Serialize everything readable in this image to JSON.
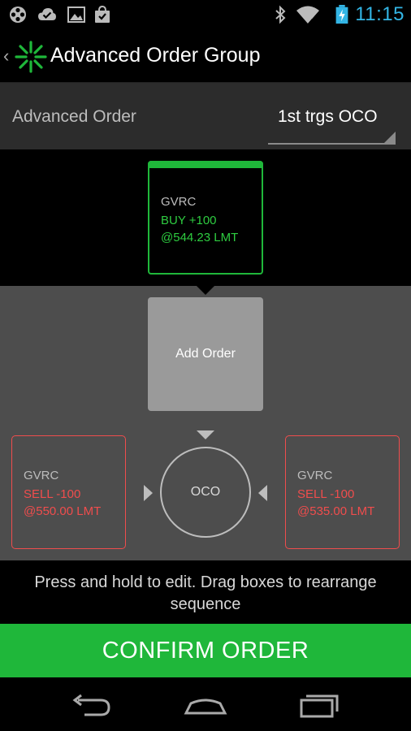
{
  "status_bar": {
    "time": "11:15",
    "icons": [
      "film-reel-icon",
      "cloud-check-icon",
      "image-icon",
      "shopping-bag-icon",
      "bluetooth-icon",
      "wifi-icon",
      "battery-charging-icon"
    ]
  },
  "action_bar": {
    "title": "Advanced Order Group",
    "logo_color": "#1fb73a"
  },
  "advanced_order": {
    "label": "Advanced Order",
    "selected": "1st trgs OCO"
  },
  "primary_order": {
    "symbol": "GVRC",
    "action": "BUY +100",
    "price": "@544.23 LMT",
    "color": "#1fb73a"
  },
  "add_order": {
    "label": "Add Order"
  },
  "oco": {
    "label": "OCO"
  },
  "left_order": {
    "symbol": "GVRC",
    "action": "SELL -100",
    "price": "@550.00 LMT",
    "color": "#f04d4d"
  },
  "right_order": {
    "symbol": "GVRC",
    "action": "SELL -100",
    "price": "@535.00 LMT",
    "color": "#f04d4d"
  },
  "hint": {
    "text": "Press and hold to edit. Drag boxes to rearrange sequence"
  },
  "confirm": {
    "label": "CONFIRM ORDER"
  },
  "nav_bar": {
    "buttons": [
      "back-icon",
      "home-icon",
      "recent-apps-icon"
    ]
  }
}
